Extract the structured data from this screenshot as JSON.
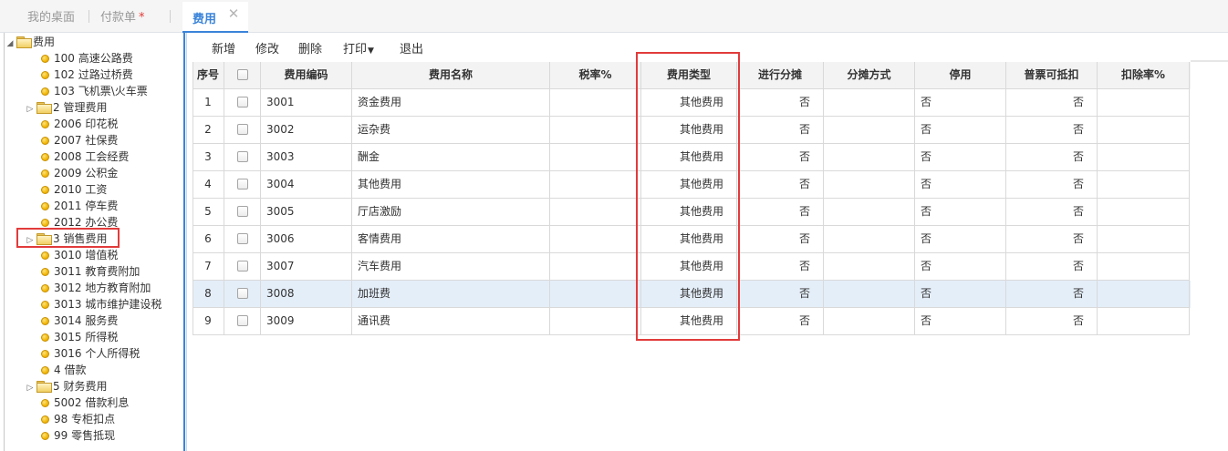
{
  "tabs": {
    "desktop": "我的桌面",
    "payment": "付款单",
    "payment_dirty": "*",
    "active": "费用",
    "close": "✕"
  },
  "tree": {
    "root": "费用",
    "nodes": [
      {
        "label": "100 高速公路费",
        "kind": "leaf"
      },
      {
        "label": "102 过路过桥费",
        "kind": "leaf"
      },
      {
        "label": "103 飞机票\\火车票",
        "kind": "leaf"
      },
      {
        "label": "2 管理费用",
        "kind": "folder"
      },
      {
        "label": "2006 印花税",
        "kind": "leaf"
      },
      {
        "label": "2007 社保费",
        "kind": "leaf"
      },
      {
        "label": "2008 工会经费",
        "kind": "leaf"
      },
      {
        "label": "2009 公积金",
        "kind": "leaf"
      },
      {
        "label": "2010 工资",
        "kind": "leaf"
      },
      {
        "label": "2011 停车费",
        "kind": "leaf"
      },
      {
        "label": "2012 办公费",
        "kind": "leaf"
      },
      {
        "label": "3 销售费用",
        "kind": "folder"
      },
      {
        "label": "3010 增值税",
        "kind": "leaf"
      },
      {
        "label": "3011 教育费附加",
        "kind": "leaf"
      },
      {
        "label": "3012 地方教育附加",
        "kind": "leaf"
      },
      {
        "label": "3013 城市维护建设税",
        "kind": "leaf"
      },
      {
        "label": "3014 服务费",
        "kind": "leaf"
      },
      {
        "label": "3015 所得税",
        "kind": "leaf"
      },
      {
        "label": "3016 个人所得税",
        "kind": "leaf"
      },
      {
        "label": "4 借款",
        "kind": "leaf"
      },
      {
        "label": "5 财务费用",
        "kind": "folder"
      },
      {
        "label": "5002 借款利息",
        "kind": "leaf"
      },
      {
        "label": "98 专柜扣点",
        "kind": "leaf"
      },
      {
        "label": "99 零售抵现",
        "kind": "leaf"
      }
    ]
  },
  "toolbar": {
    "add": "新增",
    "edit": "修改",
    "delete": "删除",
    "print": "打印",
    "exit": "退出"
  },
  "grid": {
    "columns": [
      "序号",
      "",
      "费用编码",
      "费用名称",
      "税率%",
      "费用类型",
      "进行分摊",
      "分摊方式",
      "停用",
      "普票可抵扣",
      "扣除率%"
    ],
    "rows": [
      {
        "no": "1",
        "code": "3001",
        "name": "资金费用",
        "rate": "",
        "type": "其他费用",
        "apportion": "否",
        "method": "",
        "disabled": "否",
        "deductible": "否",
        "deduct_rate": ""
      },
      {
        "no": "2",
        "code": "3002",
        "name": "运杂费",
        "rate": "",
        "type": "其他费用",
        "apportion": "否",
        "method": "",
        "disabled": "否",
        "deductible": "否",
        "deduct_rate": ""
      },
      {
        "no": "3",
        "code": "3003",
        "name": "酬金",
        "rate": "",
        "type": "其他费用",
        "apportion": "否",
        "method": "",
        "disabled": "否",
        "deductible": "否",
        "deduct_rate": ""
      },
      {
        "no": "4",
        "code": "3004",
        "name": "其他费用",
        "rate": "",
        "type": "其他费用",
        "apportion": "否",
        "method": "",
        "disabled": "否",
        "deductible": "否",
        "deduct_rate": ""
      },
      {
        "no": "5",
        "code": "3005",
        "name": "厅店激励",
        "rate": "",
        "type": "其他费用",
        "apportion": "否",
        "method": "",
        "disabled": "否",
        "deductible": "否",
        "deduct_rate": ""
      },
      {
        "no": "6",
        "code": "3006",
        "name": "客情费用",
        "rate": "",
        "type": "其他费用",
        "apportion": "否",
        "method": "",
        "disabled": "否",
        "deductible": "否",
        "deduct_rate": ""
      },
      {
        "no": "7",
        "code": "3007",
        "name": "汽车费用",
        "rate": "",
        "type": "其他费用",
        "apportion": "否",
        "method": "",
        "disabled": "否",
        "deductible": "否",
        "deduct_rate": ""
      },
      {
        "no": "8",
        "code": "3008",
        "name": "加班费",
        "rate": "",
        "type": "其他费用",
        "apportion": "否",
        "method": "",
        "disabled": "否",
        "deductible": "否",
        "deduct_rate": ""
      },
      {
        "no": "9",
        "code": "3009",
        "name": "通讯费",
        "rate": "",
        "type": "其他费用",
        "apportion": "否",
        "method": "",
        "disabled": "否",
        "deductible": "否",
        "deduct_rate": ""
      }
    ],
    "selected_row_index": 7
  },
  "colors": {
    "accent": "#3b84d9",
    "highlight": "#e23b3b",
    "selected_row": "#e4eef9"
  }
}
